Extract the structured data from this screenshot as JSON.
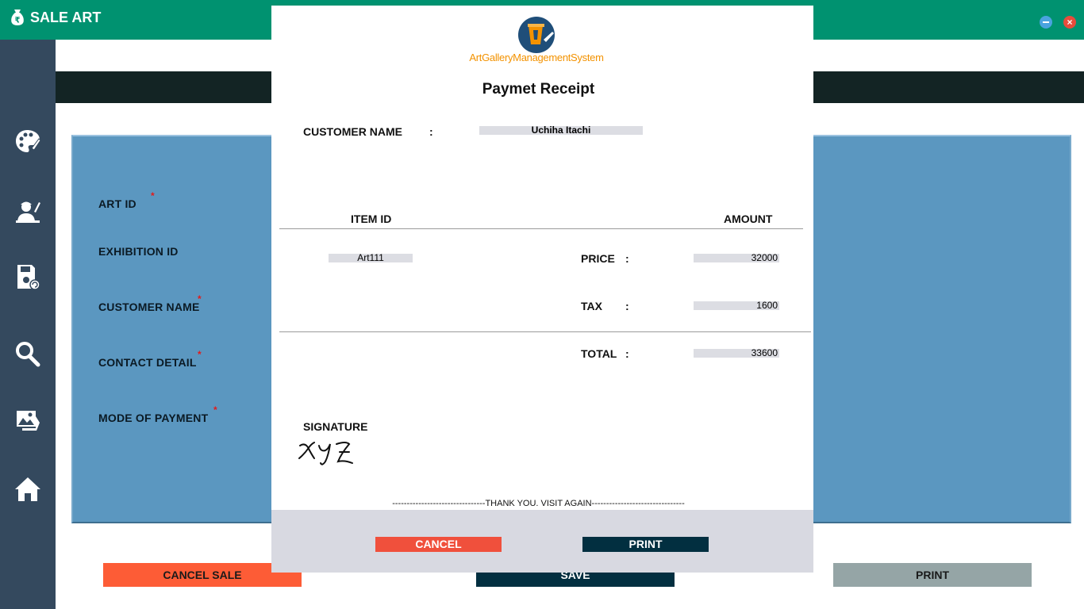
{
  "window": {
    "title": "SALE ART",
    "close_glyph": "×",
    "title_icon": "rupee-bag-icon",
    "minimize_icon": "minimize-icon",
    "close_icon": "close-icon"
  },
  "sidebar": {
    "items": [
      {
        "icon": "palette-icon"
      },
      {
        "icon": "artist-icon"
      },
      {
        "icon": "save-file-icon"
      },
      {
        "icon": "search-icon"
      },
      {
        "icon": "gallery-image-icon"
      },
      {
        "icon": "home-icon"
      }
    ]
  },
  "form": {
    "labels": {
      "art_id": "ART   ID",
      "exhibition_id": "EXHIBITION ID",
      "customer_name": "CUSTOMER NAME",
      "contact_detail": "CONTACT DETAIL",
      "mode_of_payment": "MODE OF PAYMENT"
    },
    "required_mark": "*"
  },
  "actions": {
    "cancel_sale": "CANCEL SALE",
    "save": "SAVE",
    "print": "PRINT"
  },
  "receipt": {
    "logo_text": "ArtGalleryManagementSystem",
    "title": "Paymet Receipt",
    "customer_name_label": "CUSTOMER NAME",
    "colon": ":",
    "customer_name_value": "Uchiha Itachi",
    "item_id_header": "ITEM ID",
    "amount_header": "AMOUNT",
    "item_id_value": "Art111",
    "price_label": "PRICE",
    "price_value": "32000",
    "tax_label": "TAX",
    "tax_value": "1600",
    "total_label": "TOTAL",
    "total_value": "33600",
    "signature_label": "SIGNATURE",
    "signature_text": "xyz",
    "thanks": "--------------------------------THANK YOU. VISIT AGAIN--------------------------------",
    "cancel_button": "CANCEL",
    "print_button": "PRINT"
  },
  "colors": {
    "titlebar": "#009270",
    "sidebar": "#34495e",
    "panel": "#5b97c0",
    "cancel": "#fd5c36",
    "save": "#022f40",
    "print": "#95a5a6",
    "logo_orange": "#f39200"
  }
}
